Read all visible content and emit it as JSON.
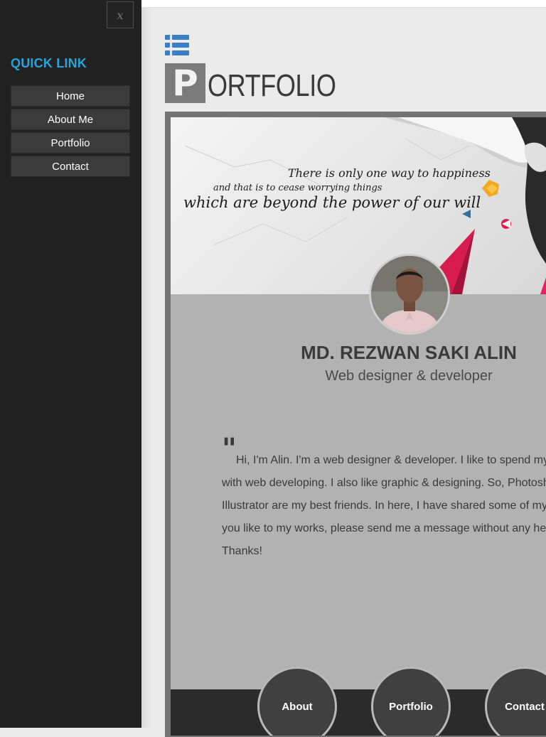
{
  "sidebar": {
    "close_label": "x",
    "quick_link_title": "QUICK LINK",
    "items": [
      {
        "label": "Home"
      },
      {
        "label": "About Me"
      },
      {
        "label": "Portfolio"
      },
      {
        "label": "Contact"
      }
    ]
  },
  "header": {
    "menu_icon": "list-icon",
    "logo_initial": "P",
    "logo_rest": "ORTFOLIO"
  },
  "banner": {
    "quote_line_1": "There is only one way to happiness",
    "quote_line_2": "and that is to cease worrying things",
    "quote_line_3": "which are beyond the power of our will"
  },
  "profile": {
    "name": "MD. REZWAN SAKI ALIN",
    "role": "Web designer & developer"
  },
  "bio": {
    "quote_mark": "\"",
    "lines": [
      "Hi, I'm Alin. I'm a web designer & developer. I like to spend my",
      "with web developing. I also like graphic & designing. So, Photosh",
      "Illustrator are my best friends. In here, I have shared some of my",
      "you like to my works, please send me a message without any he",
      "Thanks!"
    ]
  },
  "footer_nav": [
    {
      "label": "About"
    },
    {
      "label": "Portfolio"
    },
    {
      "label": "Contact"
    }
  ],
  "colors": {
    "accent": "#28a4d8",
    "sidebar_bg": "#212121",
    "menu_item_bg": "#3b3b3b",
    "content_bg": "#b2b2b2",
    "frame": "#737373",
    "circle_bg": "#404040"
  }
}
